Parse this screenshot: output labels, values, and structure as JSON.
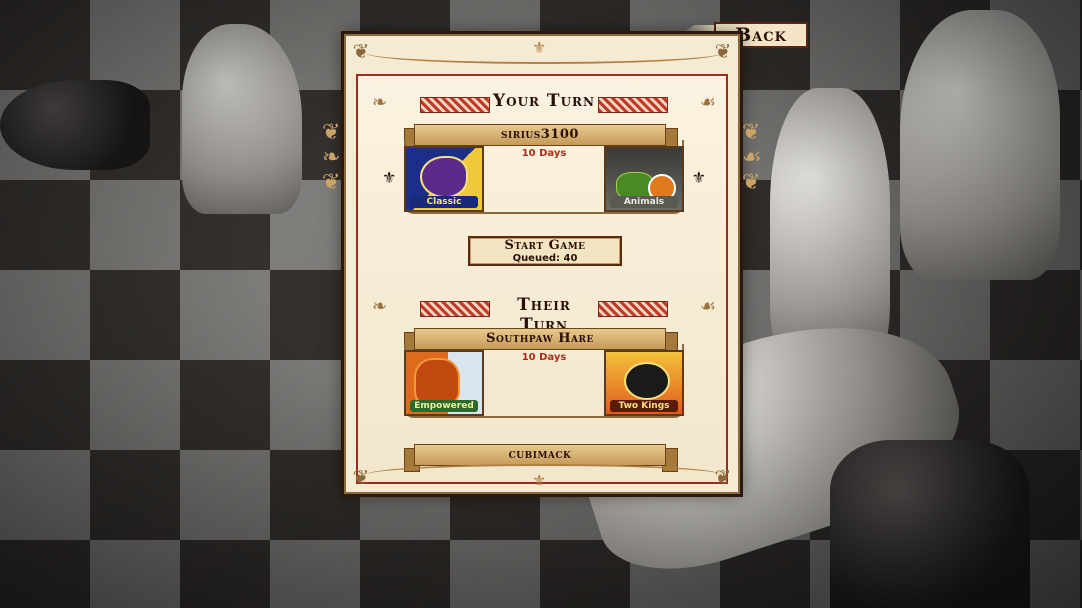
{
  "back_button": {
    "label": "Back"
  },
  "sections": {
    "your_turn": {
      "title": "Your Turn",
      "matches": [
        {
          "opponent": "sirius3100",
          "days": "10 Days",
          "left_set": "Classic",
          "right_set": "Animals"
        }
      ],
      "start_game": {
        "label": "Start Game",
        "queued": "Queued: 40"
      }
    },
    "their_turn": {
      "title": "Their Turn",
      "matches": [
        {
          "opponent": "Southpaw Hare",
          "days": "10 Days",
          "left_set": "Empowered",
          "right_set": "Two Kings"
        },
        {
          "opponent": "cubimack"
        }
      ]
    }
  },
  "colors": {
    "accent_red": "#b02a1a",
    "parchment": "#f5ead2",
    "banner_gold": "#c59a58"
  },
  "icons": [
    "fleur-de-lis-icon",
    "cursor-arrow-icon",
    "back-arrow-icon"
  ]
}
